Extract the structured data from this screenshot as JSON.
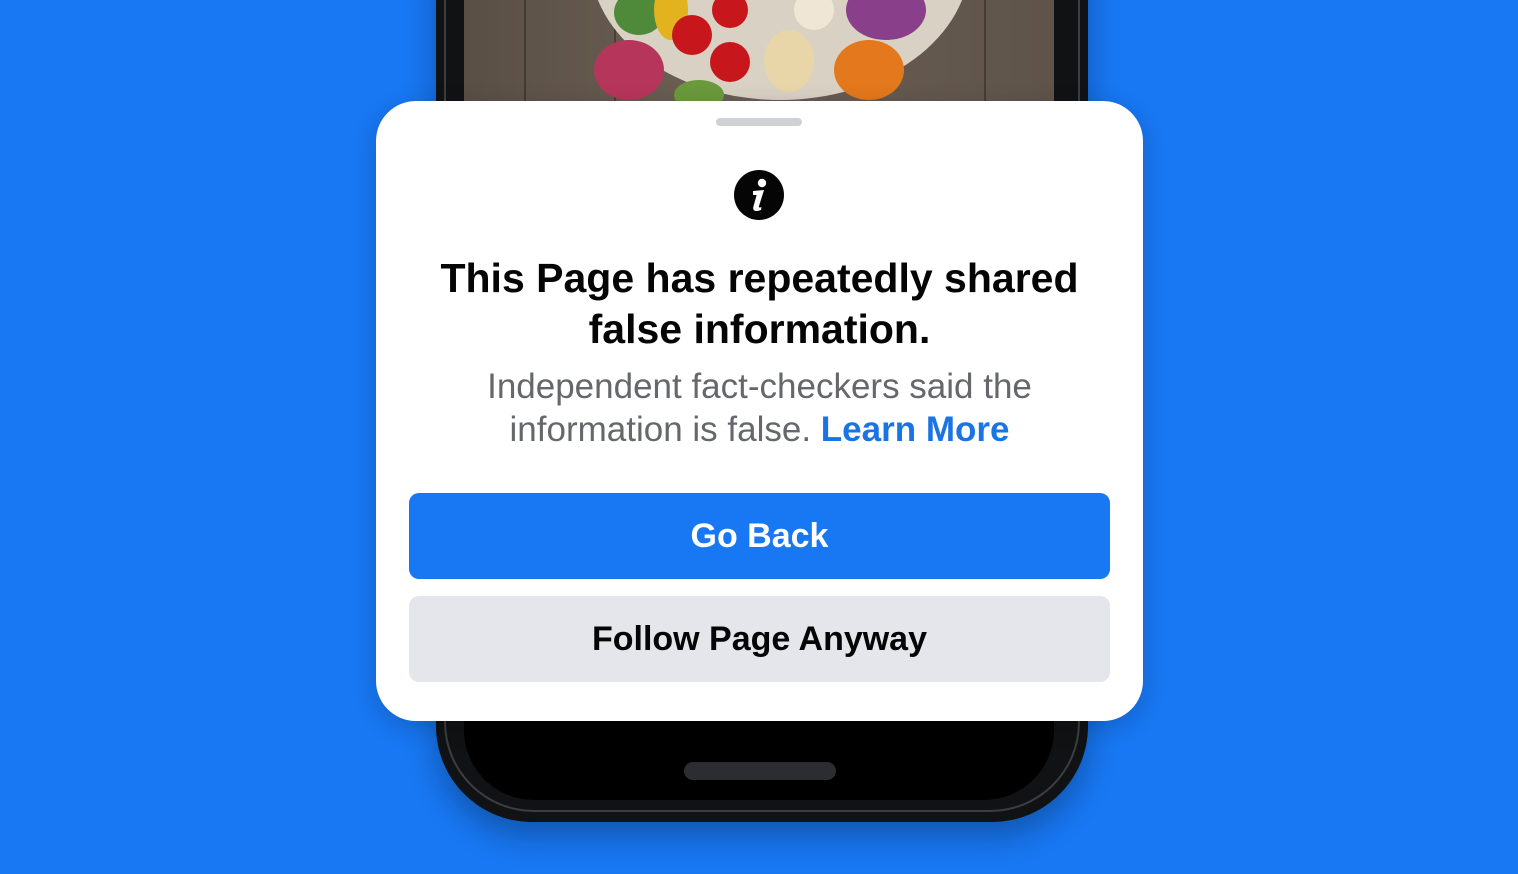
{
  "colors": {
    "background": "#1877f2",
    "primary_button": "#1877f2",
    "secondary_button": "#e4e6eb",
    "link": "#1b74e4",
    "title_text": "#050505",
    "body_text": "#65676b"
  },
  "icons": {
    "info": "info-icon"
  },
  "dialog": {
    "title": "This Page has repeatedly shared false information.",
    "description": "Independent fact-checkers said the information is false.",
    "learn_more": "Learn More",
    "primary_button": "Go Back",
    "secondary_button": "Follow Page Anyway"
  }
}
